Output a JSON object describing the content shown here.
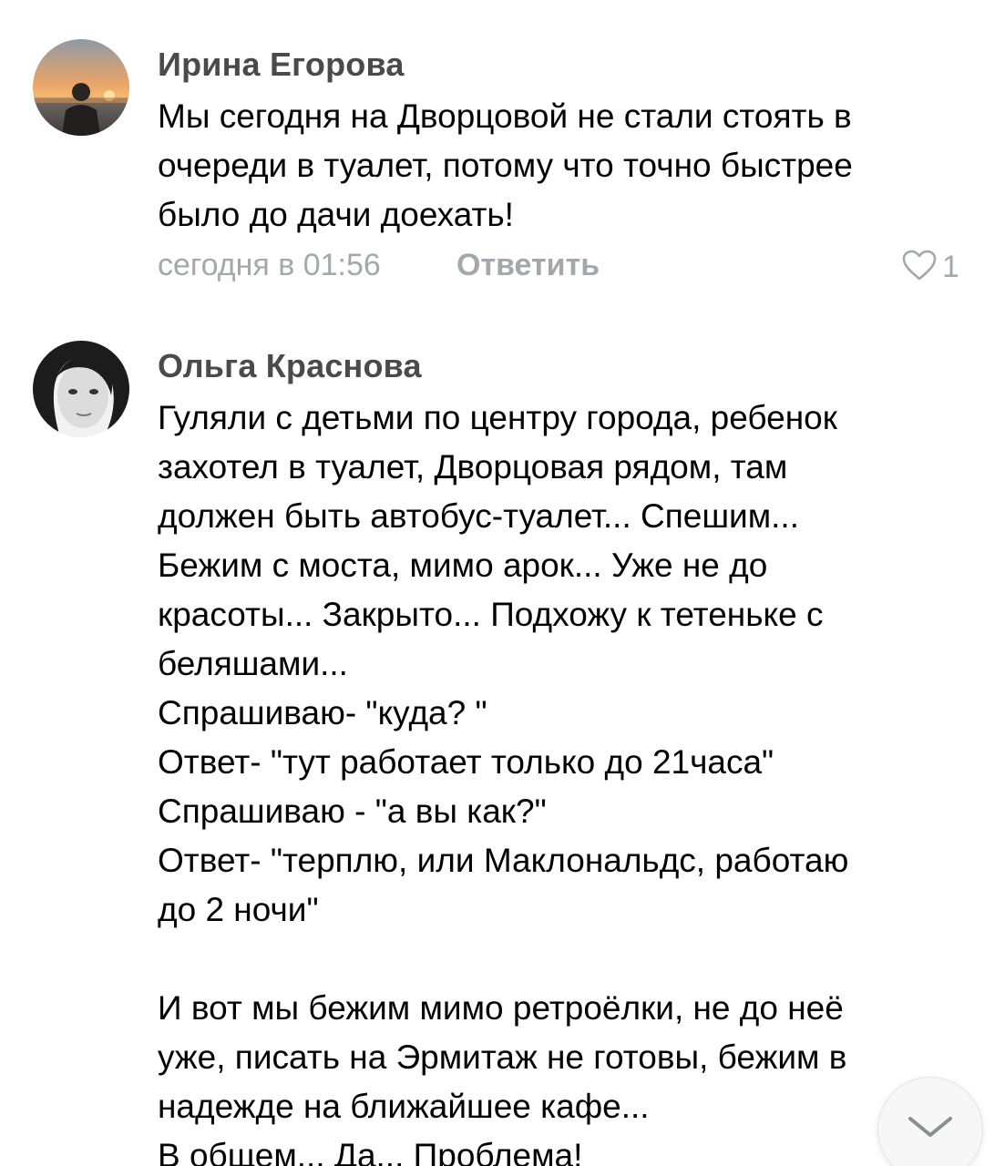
{
  "comments": [
    {
      "author": "Ирина Егорова",
      "text": "Мы сегодня на Дворцовой не стали стоять в\nочереди в туалет, потому что точно быстрее\nбыло до дачи доехать!",
      "time": "сегодня в 01:56",
      "reply_label": "Ответить",
      "likes": "1",
      "avatar": "sunset-photo-avatar"
    },
    {
      "author": "Ольга Краснова",
      "text": "Гуляли с детьми по центру города, ребенок\nзахотел в туалет, Дворцовая рядом, там\nдолжен быть автобус-туалет... Спешим...\nБежим с моста, мимо арок... Уже не до\nкрасоты... Закрыто... Подхожу к тетеньке с\nбеляшами...\nСпрашиваю- \"куда? \"\nОтвет- \"тут работает только до 21часа\"\nСпрашиваю - \"а вы как?\"\nОтвет- \"терплю, или Маклональдс, работаю\nдо 2 ночи\"\n\nИ вот мы бежим мимо ретроёлки, не до неё\nуже, писать на Эрмитаж не готовы, бежим в\nнадежде на ближайшее кафе...\nВ общем... Да... Проблема!",
      "avatar": "bw-portrait-avatar"
    }
  ],
  "icons": {
    "like": "heart-outline-icon",
    "scroll": "chevron-down-icon"
  },
  "colors": {
    "author": "#4a4a4a",
    "meta": "#a4a7ab",
    "text": "#000000"
  }
}
